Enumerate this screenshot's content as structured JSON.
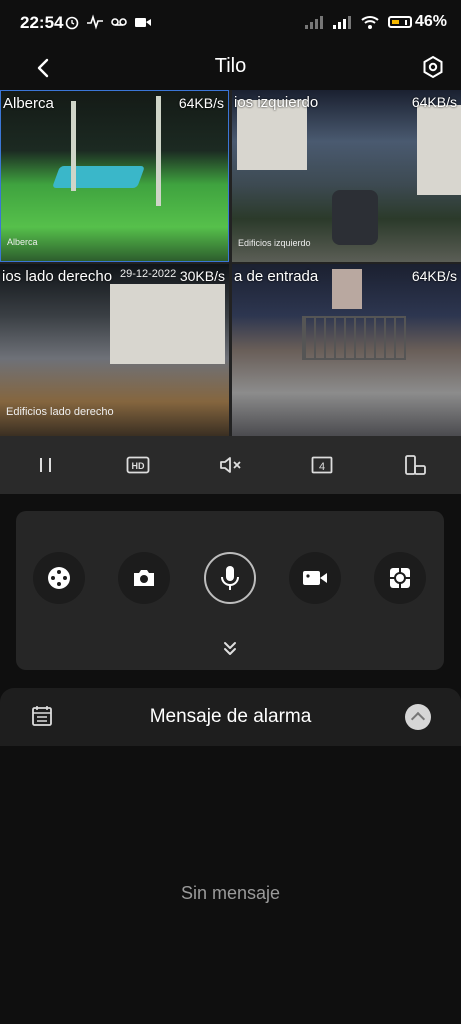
{
  "status_bar": {
    "time": "22:54",
    "left_icons": [
      "alarm-icon",
      "pulse-icon",
      "voicemail-icon",
      "video-icon"
    ],
    "right_icons": [
      "signal-icon",
      "signal-icon",
      "wifi-icon",
      "battery-icon"
    ],
    "battery": "46%"
  },
  "header": {
    "title": "Tilo"
  },
  "cameras": [
    {
      "label": "Alberca",
      "rate": "64KB/s",
      "osd": "Alberca",
      "date": ""
    },
    {
      "label": "ios izquierdo",
      "rate": "64KB/s",
      "osd": "Edificios izquierdo",
      "date": ""
    },
    {
      "label": "ios lado derecho",
      "rate": "30KB/s",
      "osd": "Edificios lado derecho",
      "date": "29-12-2022"
    },
    {
      "label": "a de entrada",
      "rate": "64KB/s",
      "osd": "",
      "date": ""
    }
  ],
  "controls": {
    "pause": "pause-icon",
    "hd": "HD",
    "mute": "mute-icon",
    "split": "4",
    "rotate": "rotate-device-icon"
  },
  "panel": {
    "actions": [
      "ptz-icon",
      "snapshot-icon",
      "microphone-icon",
      "record-icon",
      "target-icon"
    ]
  },
  "alarm": {
    "title": "Mensaje de alarma",
    "empty_text": "Sin mensaje"
  }
}
